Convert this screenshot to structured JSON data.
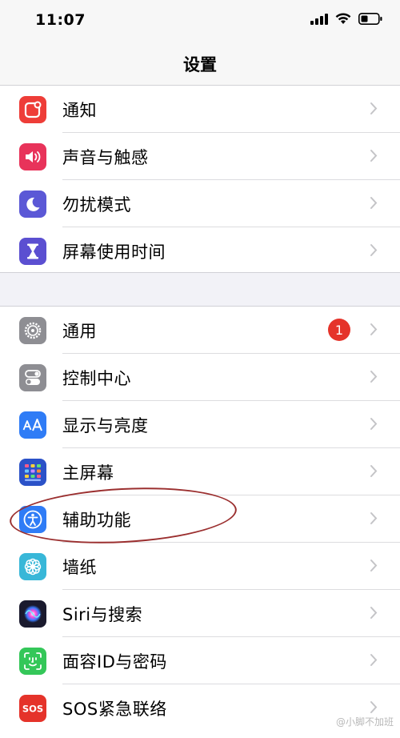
{
  "status_bar": {
    "time": "11:07",
    "icons": [
      "cellular-signal-icon",
      "wifi-icon",
      "battery-icon"
    ]
  },
  "nav": {
    "title": "设置"
  },
  "groups": [
    {
      "items": [
        {
          "label": "通知",
          "icon": "notification-icon",
          "icon_color": "#ee3d38"
        },
        {
          "label": "声音与触感",
          "icon": "speaker-icon",
          "icon_color": "#e8335a"
        },
        {
          "label": "勿扰模式",
          "icon": "moon-icon",
          "icon_color": "#5b58d6"
        },
        {
          "label": "屏幕使用时间",
          "icon": "hourglass-icon",
          "icon_color": "#5b4fd1"
        }
      ]
    },
    {
      "items": [
        {
          "label": "通用",
          "icon": "gear-icon",
          "icon_color": "#8e8e93",
          "badge": "1"
        },
        {
          "label": "控制中心",
          "icon": "toggles-icon",
          "icon_color": "#8e8e93"
        },
        {
          "label": "显示与亮度",
          "icon": "text-size-icon",
          "icon_color": "#2f7cf6"
        },
        {
          "label": "主屏幕",
          "icon": "home-screen-grid-icon",
          "icon_color": "#2b52c8"
        },
        {
          "label": "辅助功能",
          "icon": "accessibility-icon",
          "icon_color": "#2f7cf6",
          "highlighted": true
        },
        {
          "label": "墙纸",
          "icon": "wallpaper-flower-icon",
          "icon_color": "#38b7d8"
        },
        {
          "label": "Siri与搜索",
          "icon": "siri-icon",
          "icon_color": "#1a1a2e"
        },
        {
          "label": "面容ID与密码",
          "icon": "face-id-icon",
          "icon_color": "#34c759"
        },
        {
          "label": "SOS紧急联络",
          "icon": "sos-icon",
          "icon_color": "#e5332a"
        }
      ]
    }
  ],
  "watermark": "@小脚不加班"
}
